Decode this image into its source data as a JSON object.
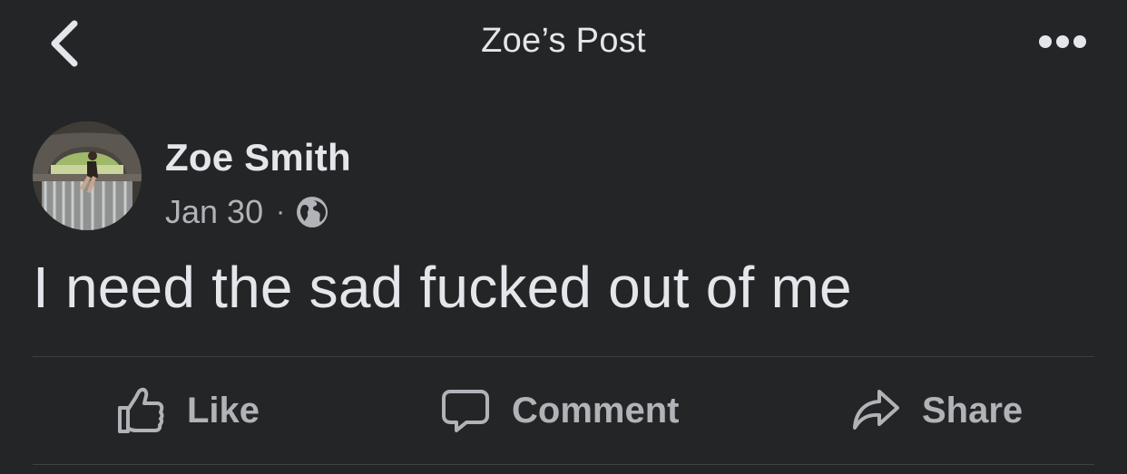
{
  "header": {
    "title": "Zoe’s Post"
  },
  "post": {
    "author": "Zoe Smith",
    "date": "Jan 30",
    "separator": "·",
    "audience_icon": "globe-icon",
    "text": "I need the sad fucked out of me"
  },
  "actions": {
    "like_label": "Like",
    "comment_label": "Comment",
    "share_label": "Share"
  },
  "colors": {
    "background": "#242526",
    "primary_text": "#e4e6eb",
    "secondary_text": "#b0b3b8",
    "divider": "#3e4042"
  }
}
